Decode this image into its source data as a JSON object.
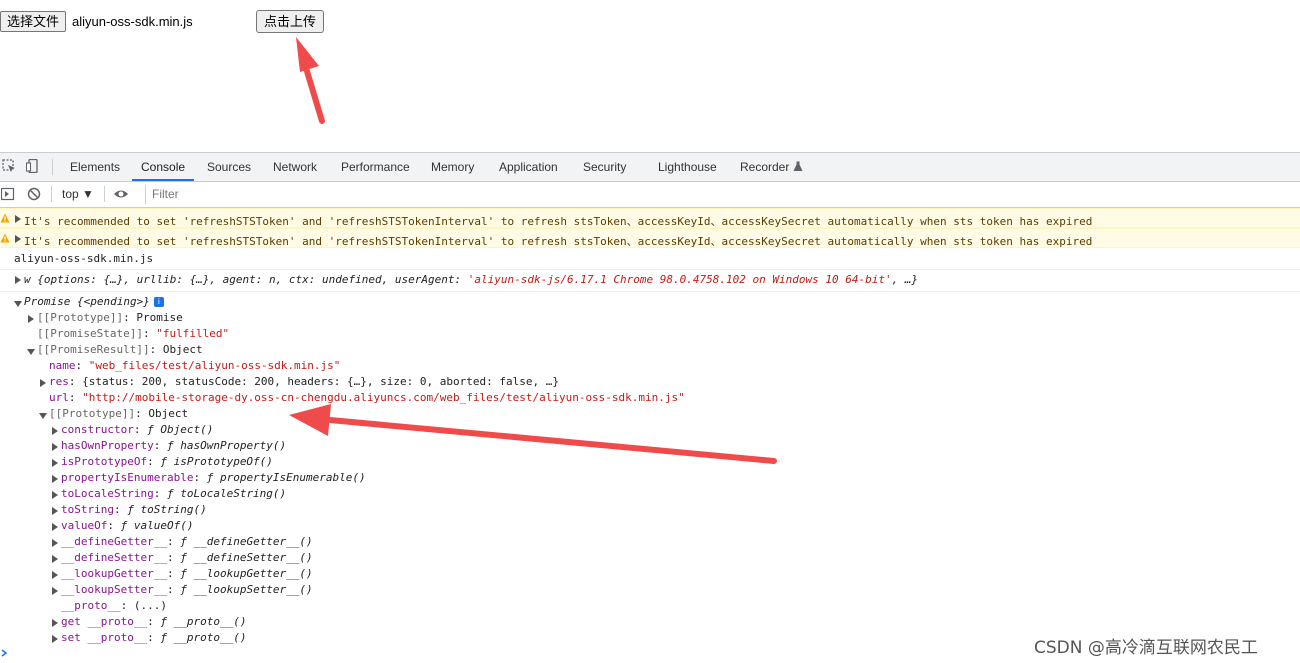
{
  "page": {
    "choose_file_label": "选择文件",
    "file_name": "aliyun-oss-sdk.min.js",
    "upload_label": "点击上传"
  },
  "devtools": {
    "tabs": [
      "Elements",
      "Console",
      "Sources",
      "Network",
      "Performance",
      "Memory",
      "Application",
      "Security",
      "Lighthouse",
      "Recorder"
    ],
    "active_tab": "Console",
    "context": "top ▼",
    "filter_placeholder": "Filter",
    "accent": "#1a73e8"
  },
  "console": {
    "warning_text": "It's recommended to set 'refreshSTSToken' and 'refreshSTSTokenInterval' to refresh stsToken、accessKeyId、accessKeySecret automatically when sts token has expired",
    "log_filename": "aliyun-oss-sdk.min.js",
    "w_prefix": "w {options: {…}, urllib: {…}, agent: n, ctx: undefined, userAgent: ",
    "w_useragent": "'aliyun-sdk-js/6.17.1 Chrome 98.0.4758.102 on Windows 10 64-bit'",
    "w_suffix": ", …}",
    "promise_label": "Promise {<pending>}",
    "prototype_promise_key": "[[Prototype]]",
    "prototype_promise_val": "Promise",
    "promise_state_key": "[[PromiseState]]",
    "promise_state_val": "\"fulfilled\"",
    "promise_result_key": "[[PromiseResult]]",
    "promise_result_val": "Object",
    "name_key": "name",
    "name_val": "\"web_files/test/aliyun-oss-sdk.min.js\"",
    "res_key": "res",
    "res_val": "{status: 200, statusCode: 200, headers: {…}, size: 0, aborted: false, …}",
    "url_key": "url",
    "url_val": "\"http://mobile-storage-dy.oss-cn-chengdu.aliyuncs.com/web_files/test/aliyun-oss-sdk.min.js\"",
    "proto_obj_key": "[[Prototype]]",
    "proto_obj_val": "Object",
    "proto_members": [
      {
        "key": "constructor",
        "val": "ƒ Object()"
      },
      {
        "key": "hasOwnProperty",
        "val": "ƒ hasOwnProperty()"
      },
      {
        "key": "isPrototypeOf",
        "val": "ƒ isPrototypeOf()"
      },
      {
        "key": "propertyIsEnumerable",
        "val": "ƒ propertyIsEnumerable()"
      },
      {
        "key": "toLocaleString",
        "val": "ƒ toLocaleString()"
      },
      {
        "key": "toString",
        "val": "ƒ toString()"
      },
      {
        "key": "valueOf",
        "val": "ƒ valueOf()"
      },
      {
        "key": "__defineGetter__",
        "val": "ƒ __defineGetter__()"
      },
      {
        "key": "__defineSetter__",
        "val": "ƒ __defineSetter__()"
      },
      {
        "key": "__lookupGetter__",
        "val": "ƒ __lookupGetter__()"
      },
      {
        "key": "__lookupSetter__",
        "val": "ƒ __lookupSetter__()"
      },
      {
        "key": "__proto__",
        "val": "(...)"
      },
      {
        "key": "get __proto__",
        "val": "ƒ __proto__()"
      },
      {
        "key": "set __proto__",
        "val": "ƒ __proto__()"
      }
    ]
  },
  "watermark": "CSDN @高冷滴互联网农民工",
  "annotation_color": "#f04b4b"
}
